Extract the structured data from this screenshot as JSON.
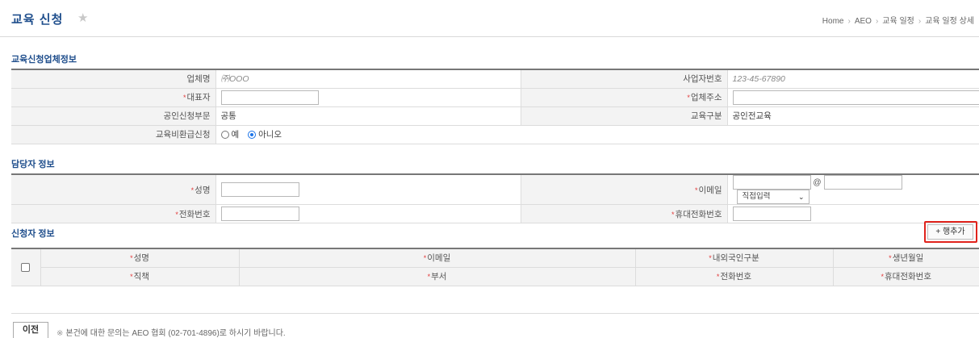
{
  "header": {
    "title": "교육 신청",
    "breadcrumb": [
      "Home",
      "AEO",
      "교육 일정",
      "교육 일정 상세"
    ]
  },
  "company_section": {
    "title": "교육신청업체정보",
    "company_name_label": "업체명",
    "company_name_value": "㈜OOO",
    "biz_number_label": "사업자번호",
    "biz_number_value": "123-45-67890",
    "ceo_label": "대표자",
    "ceo_value": "",
    "address_label": "업체주소",
    "address_value": "",
    "cert_dept_label": "공인신청부문",
    "cert_dept_value": "공통",
    "edu_type_label": "교육구분",
    "edu_type_value": "공인전교육",
    "refund_label": "교육비환급신청",
    "refund_yes": "예",
    "refund_no": "아니오",
    "refund_selected": "아니오"
  },
  "contact_section": {
    "title": "담당자 정보",
    "name_label": "성명",
    "email_label": "이메일",
    "email_at": "@",
    "email_domain_select": "직접입력",
    "phone_label": "전화번호",
    "mobile_label": "휴대전화번호"
  },
  "applicant_section": {
    "title": "신청자 정보",
    "add_row_label": "+ 행추가",
    "columns_row1": [
      "성명",
      "이메일",
      "내외국인구분",
      "생년월일"
    ],
    "columns_row2": [
      "직책",
      "부서",
      "전화번호",
      "휴대전화번호"
    ]
  },
  "footer": {
    "prev_label": "이전",
    "notice_mark": "※",
    "notice_text": "본건에 대한 문의는 AEO 협회 (02-701-4896)로 하시기 바랍니다."
  },
  "colors": {
    "title_blue": "#1f4e8c",
    "required_red": "#e23a3a",
    "highlight_red": "#e0231c",
    "radio_blue": "#1a73e8"
  }
}
